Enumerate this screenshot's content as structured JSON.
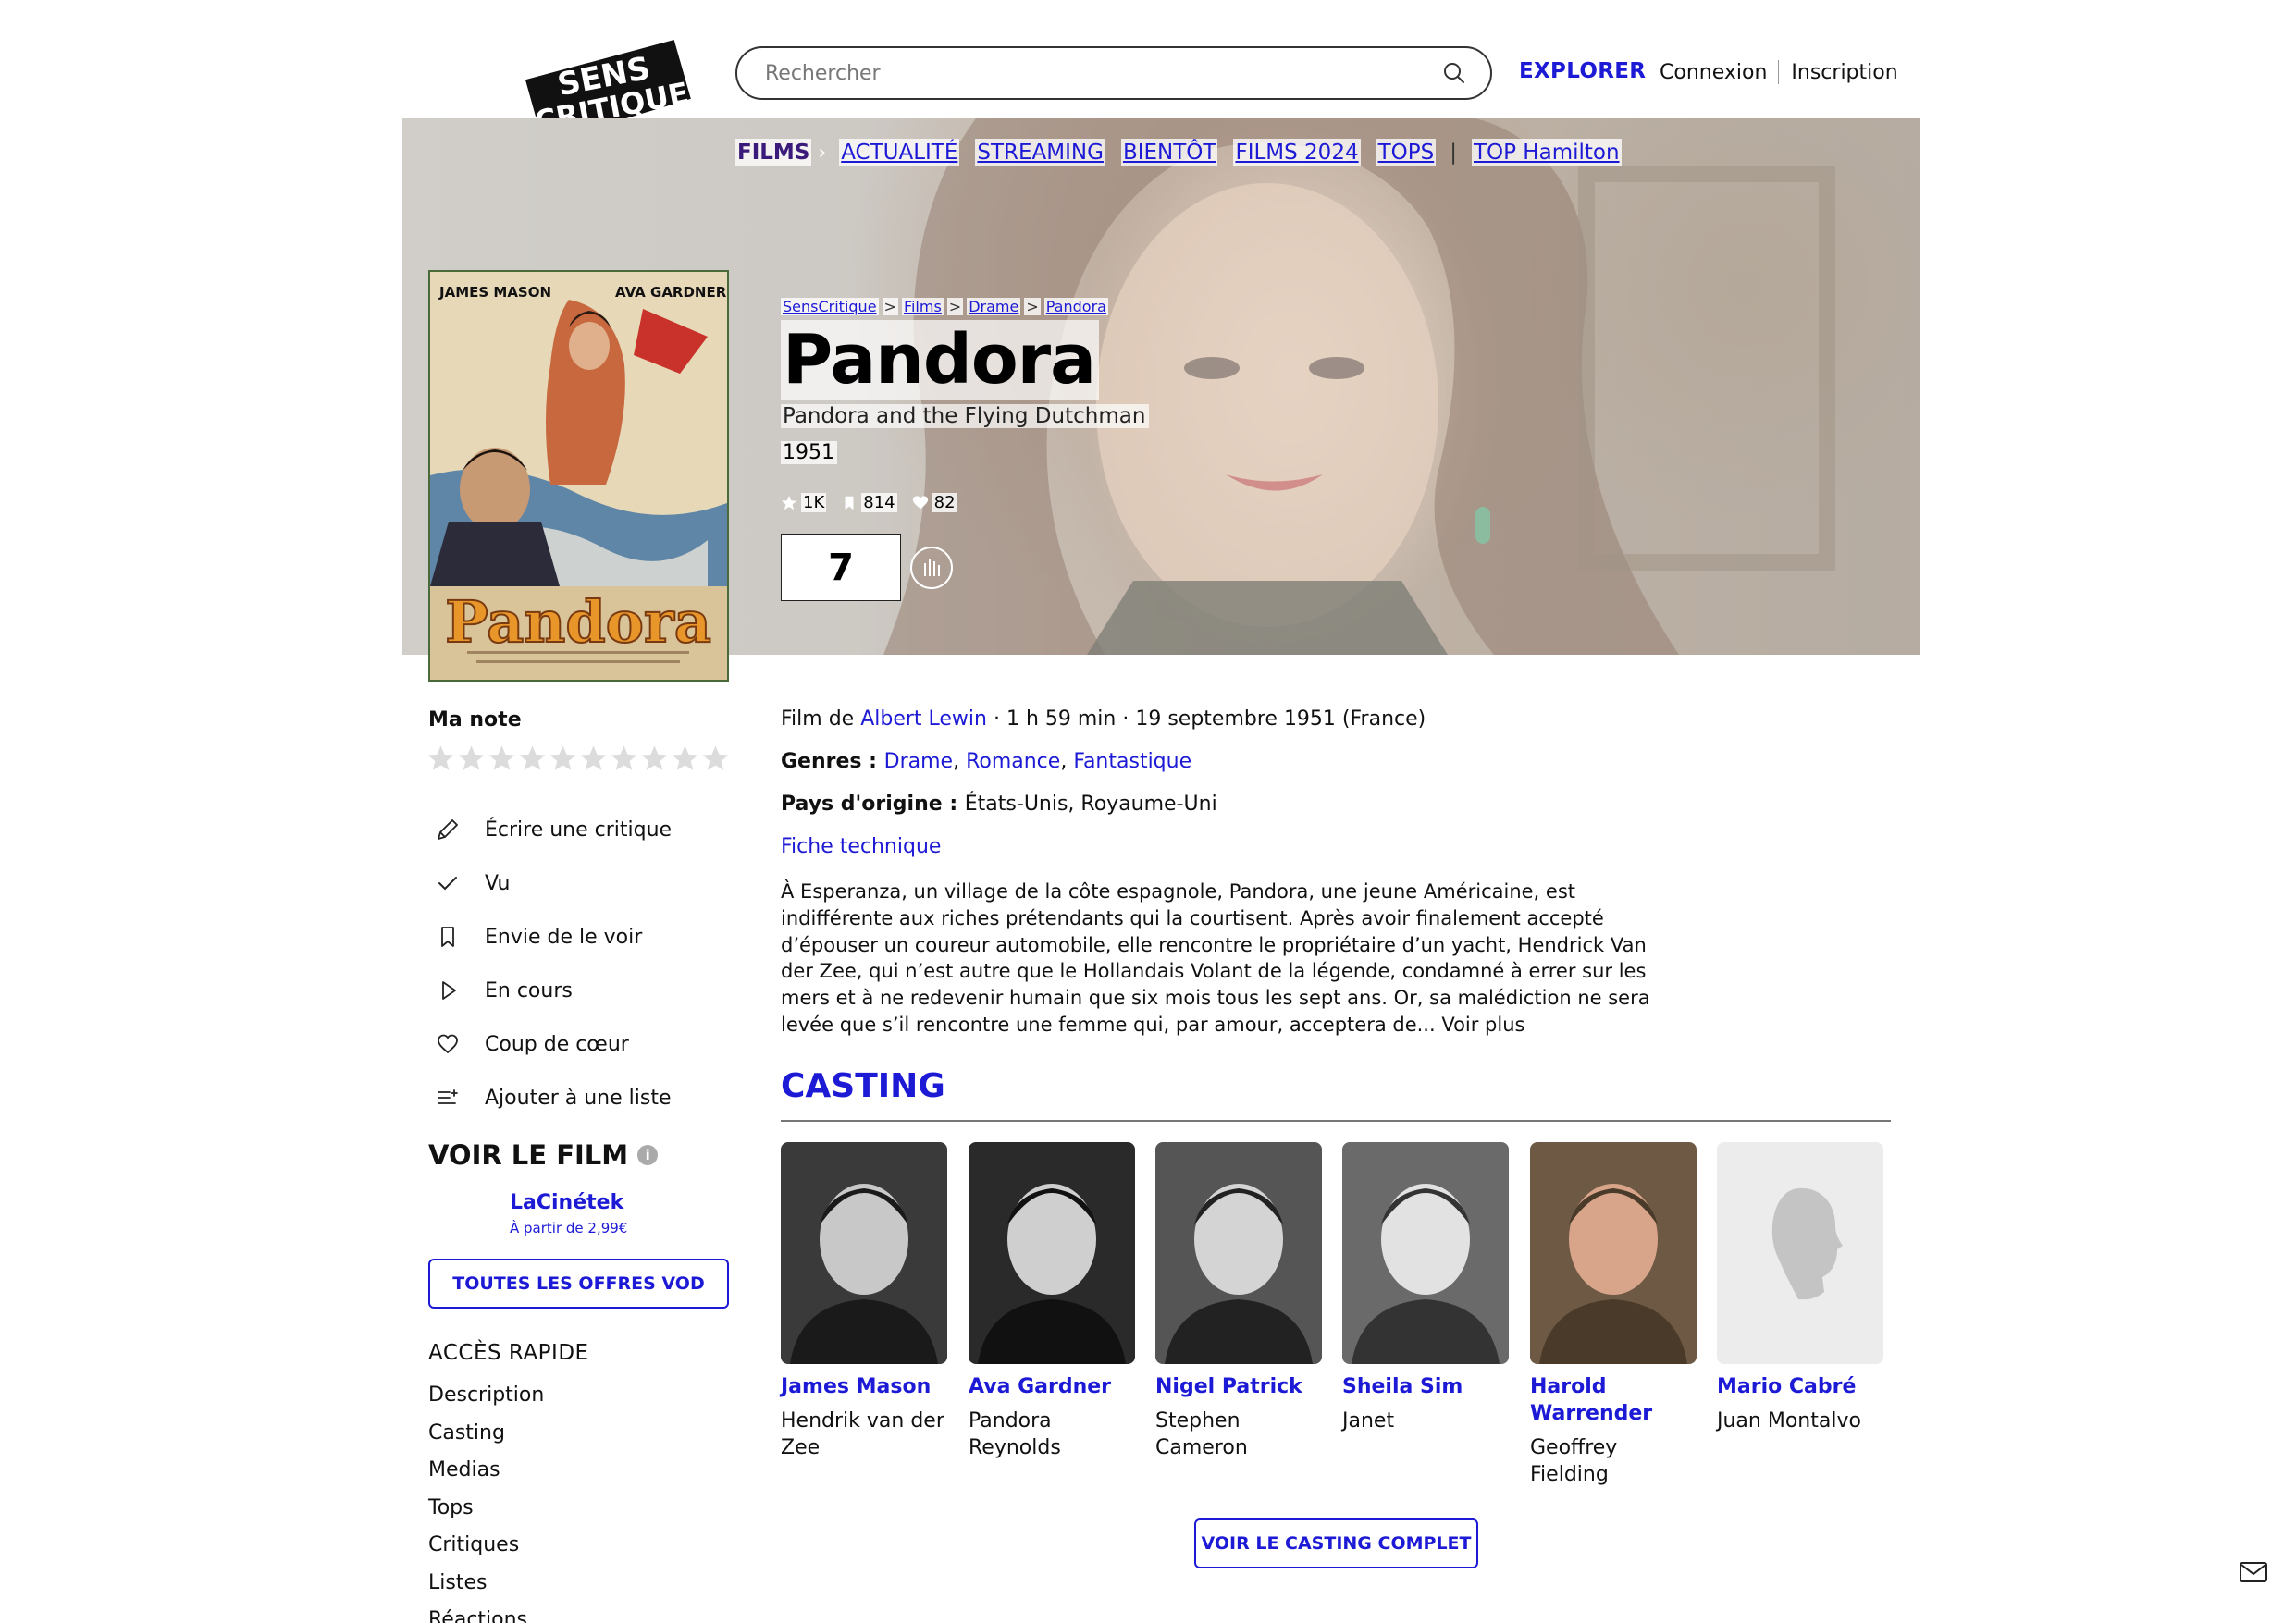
{
  "header": {
    "logo_line1": "SENS",
    "logo_line2": "CRITIQUE",
    "search_placeholder": "Rechercher",
    "explorer": "EXPLORER",
    "login": "Connexion",
    "signup": "Inscription"
  },
  "nav": {
    "items": [
      "FILMS",
      "ACTUALITÉ",
      "STREAMING",
      "BIENTÔT",
      "FILMS 2024",
      "TOPS",
      "TOP Hamilton"
    ]
  },
  "breadcrumb": [
    "SensCritique",
    "Films",
    "Drame",
    "Pandora"
  ],
  "film": {
    "title": "Pandora",
    "original_title": "Pandora and the Flying Dutchman",
    "year": "1951",
    "stats": {
      "ratings": "1K",
      "wishlists": "814",
      "favorites": "82"
    },
    "score": "7",
    "poster": {
      "actor_left": "JAMES MASON",
      "actor_right": "AVA GARDNER",
      "title": "Pandora"
    }
  },
  "sidebar": {
    "my_rating_label": "Ma note",
    "star_count": 10,
    "actions": [
      {
        "label": "Écrire une critique",
        "icon": "pencil-icon"
      },
      {
        "label": "Vu",
        "icon": "check-icon"
      },
      {
        "label": "Envie de le voir",
        "icon": "bookmark-icon"
      },
      {
        "label": "En cours",
        "icon": "play-icon"
      },
      {
        "label": "Coup de cœur",
        "icon": "heart-icon"
      },
      {
        "label": "Ajouter à une liste",
        "icon": "add-list-icon"
      }
    ],
    "watch_title": "VOIR LE FILM",
    "offer": {
      "provider": "LaCinétek",
      "price": "À partir de 2,99€"
    },
    "vod_button": "TOUTES LES OFFRES VOD",
    "quick_access_title": "ACCÈS RAPIDE",
    "quick_links": [
      "Description",
      "Casting",
      "Medias",
      "Tops",
      "Critiques",
      "Listes",
      "Réactions"
    ]
  },
  "details": {
    "film_by_prefix": "Film de ",
    "director": "Albert Lewin",
    "duration_release": " · 1 h 59 min · 19 septembre 1951 (France)",
    "genres_label": "Genres : ",
    "genres": [
      "Drame",
      "Romance",
      "Fantastique"
    ],
    "country_label": "Pays d'origine : ",
    "countries": "États-Unis, Royaume-Uni",
    "tech_sheet": "Fiche technique",
    "synopsis_lines": [
      "À Esperanza, un village de la côte espagnole, Pandora, une jeune Américaine, est",
      "indifférente aux riches prétendants qui la courtisent. Après avoir finalement accepté",
      "d’épouser un coureur automobile, elle rencontre le propriétaire d’un yacht, Hendrick Van",
      "der Zee, qui n’est autre que le Hollandais Volant de la légende, condamné à errer sur les",
      "mers et à ne redevenir humain que six mois tous les sept ans. Or, sa malédiction ne sera",
      "levée que s’il rencontre une femme qui, par amour, acceptera de... Voir plus"
    ]
  },
  "casting": {
    "title": "CASTING",
    "members": [
      {
        "name": [
          "James Mason"
        ],
        "role": [
          "Hendrik van der",
          "Zee"
        ],
        "photo": "portrait-bw"
      },
      {
        "name": [
          "Ava Gardner"
        ],
        "role": [
          "Pandora",
          "Reynolds"
        ],
        "photo": "portrait-bw"
      },
      {
        "name": [
          "Nigel Patrick"
        ],
        "role": [
          "Stephen",
          "Cameron"
        ],
        "photo": "portrait-bw"
      },
      {
        "name": [
          "Sheila Sim"
        ],
        "role": [
          "Janet"
        ],
        "photo": "portrait-bw"
      },
      {
        "name": [
          "Harold",
          "Warrender"
        ],
        "role": [
          "Geoffrey",
          "Fielding"
        ],
        "photo": "portrait-color"
      },
      {
        "name": [
          "Mario Cabré"
        ],
        "role": [
          "Juan Montalvo"
        ],
        "photo": "silhouette-placeholder"
      }
    ],
    "full_cast_button": "VOIR LE CASTING COMPLET"
  },
  "colors": {
    "accent": "#1d1ad6",
    "text": "#111111"
  }
}
